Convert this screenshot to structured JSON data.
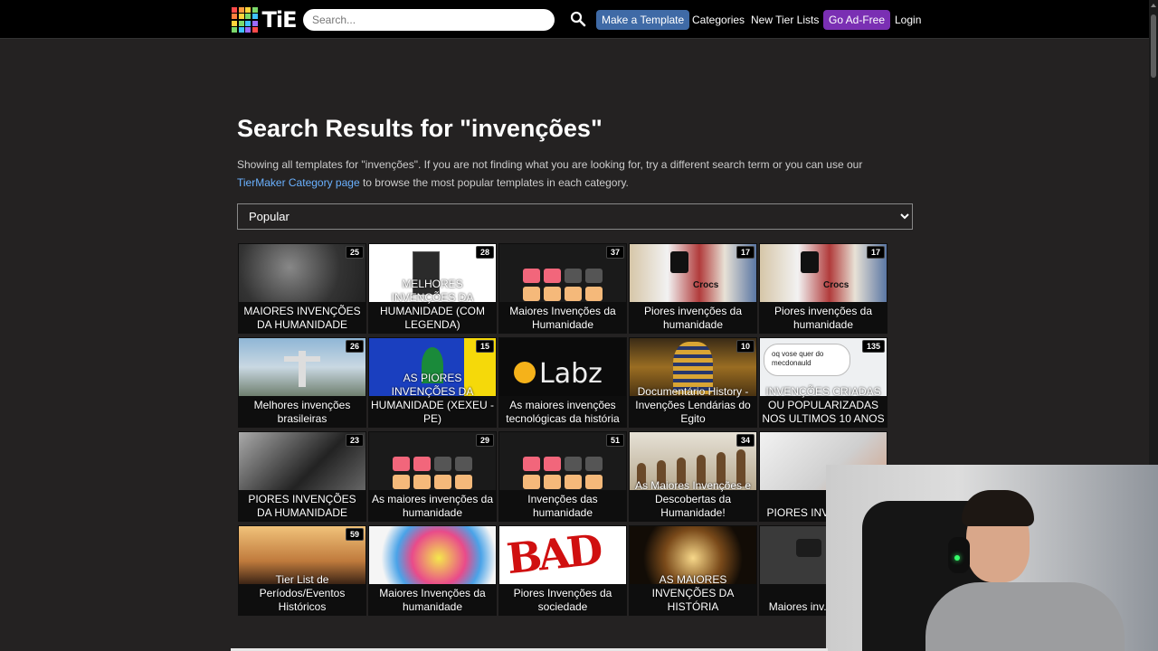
{
  "header": {
    "logo_text": "TiE",
    "logo_colors": [
      "#ff4a4a",
      "#ff9b3d",
      "#ffd43b",
      "#7bd96b",
      "#ff7f3d",
      "#ffd43b",
      "#7bd96b",
      "#3fc1ff",
      "#ffd43b",
      "#7bd96b",
      "#3fc1ff",
      "#9b6bff",
      "#7bd96b",
      "#3fc1ff",
      "#9b6bff",
      "#ff4a4a"
    ],
    "search_placeholder": "Search...",
    "nav": {
      "make_template": "Make a Template",
      "categories": "Categories",
      "new_tier_lists": "New Tier Lists",
      "go_ad_free": "Go Ad-Free",
      "login": "Login"
    },
    "colors": {
      "make_template_bg": "#3f6aa6",
      "ad_free_bg": "#7a2fb3"
    }
  },
  "main": {
    "title": "Search Results for \"invenções\"",
    "desc_prefix": "Showing all templates for \"invenções\". If you are not finding what you are looking for, try a different search term or you can use our ",
    "desc_link": "TierMaker Category page",
    "desc_suffix": " to browse the most popular templates in each category.",
    "sort_selected": "Popular"
  },
  "cards": [
    {
      "title": "MAIORES INVENÇÕES DA HUMANIDADE",
      "count": "25",
      "thumb": "tech"
    },
    {
      "title": "MELHORES INVENÇÕES DA HUMANIDADE (COM LEGENDA)",
      "count": "28",
      "thumb": "fridge"
    },
    {
      "title": "Maiores Invenções da Humanidade",
      "count": "37",
      "thumb": "squares"
    },
    {
      "title": "Piores invenções da humanidade",
      "count": "17",
      "thumb": "collage",
      "thumb_text": "Crocs"
    },
    {
      "title": "Piores invenções da humanidade",
      "count": "17",
      "thumb": "collage",
      "thumb_text": "Crocs"
    },
    {
      "title": "Melhores invenções brasileiras",
      "count": "26",
      "thumb": "christ"
    },
    {
      "title": "AS PIORES INVENÇÕES DA HUMANIDADE (XEXEU - PE)",
      "count": "15",
      "thumb": "flag"
    },
    {
      "title": "As maiores invenções tecnológicas da história",
      "count": "",
      "thumb": "labz",
      "thumb_text": "Labz"
    },
    {
      "title": "Documentário History - Invenções Lendárias do Egito",
      "count": "10",
      "thumb": "egypt"
    },
    {
      "title": "INVENÇÕES CRIADAS OU POPULARIZADAS NOS ULTIMOS 10 ANOS",
      "count": "135",
      "thumb": "talk",
      "thumb_text": "oq vose quer do mecdonauld"
    },
    {
      "title": "PIORES INVENÇÕES DA HUMANIDADE",
      "count": "23",
      "thumb": "sad"
    },
    {
      "title": "As maiores invenções da humanidade",
      "count": "29",
      "thumb": "squares"
    },
    {
      "title": "Invenções das humanidade",
      "count": "51",
      "thumb": "squares"
    },
    {
      "title": "As Maiores Invenções e Descobertas da Humanidade!",
      "count": "34",
      "thumb": "evo"
    },
    {
      "title": "PIORES INVE... TOD...",
      "count": "",
      "thumb": "hands"
    },
    {
      "title": "Tier List de Períodos/Eventos Históricos",
      "count": "59",
      "thumb": "period"
    },
    {
      "title": "Maiores Invenções da humanidade",
      "count": "",
      "thumb": "rainbow"
    },
    {
      "title": "Piores Invenções da sociedade",
      "count": "",
      "thumb": "bad",
      "thumb_text": "BAD"
    },
    {
      "title": "AS MAIORES INVENÇÕES DA HISTÓRIA",
      "count": "",
      "thumb": "bulb"
    },
    {
      "title": "Maiores inv... human...",
      "count": "",
      "thumb": "film"
    }
  ]
}
